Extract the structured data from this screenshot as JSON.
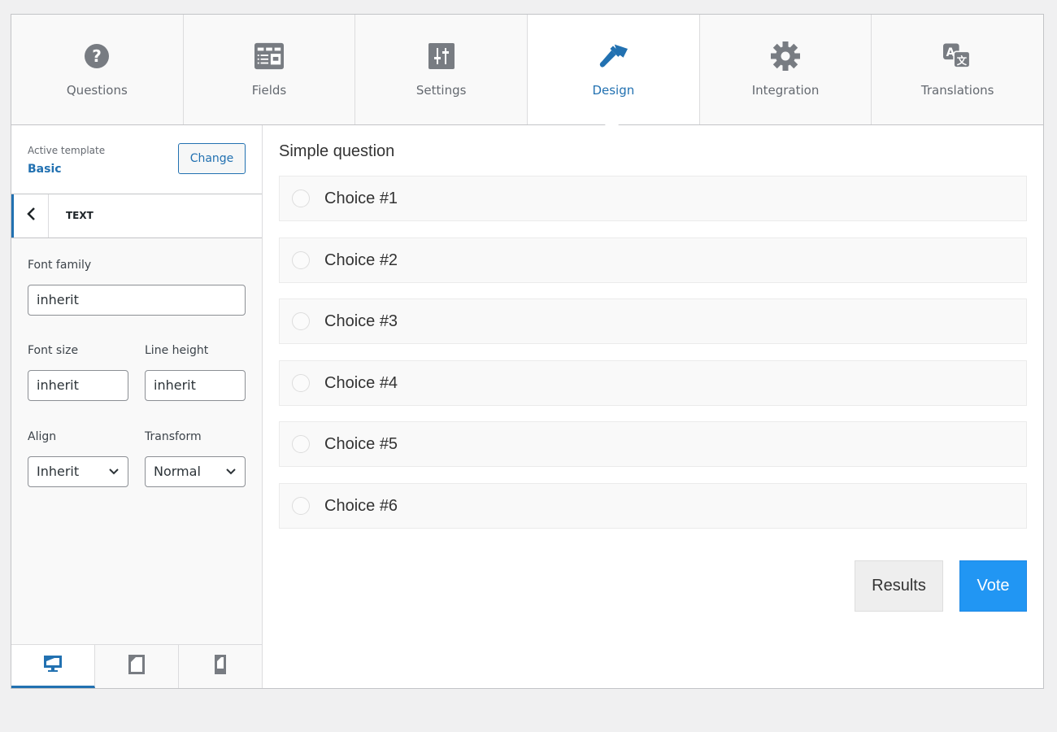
{
  "tabs": [
    {
      "label": "Questions",
      "icon": "question-circle-icon",
      "active": false
    },
    {
      "label": "Fields",
      "icon": "form-fields-icon",
      "active": false
    },
    {
      "label": "Settings",
      "icon": "sliders-icon",
      "active": false
    },
    {
      "label": "Design",
      "icon": "paintbrush-icon",
      "active": true
    },
    {
      "label": "Integration",
      "icon": "gear-icon",
      "active": false
    },
    {
      "label": "Translations",
      "icon": "translation-icon",
      "active": false
    }
  ],
  "sidebar": {
    "template_label": "Active template",
    "template_name": "Basic",
    "change_label": "Change",
    "section_title": "TEXT",
    "font_family": {
      "label": "Font family",
      "value": "inherit"
    },
    "font_size": {
      "label": "Font size",
      "value": "inherit"
    },
    "line_height": {
      "label": "Line height",
      "value": "inherit"
    },
    "align": {
      "label": "Align",
      "value": "Inherit"
    },
    "transform": {
      "label": "Transform",
      "value": "Normal"
    },
    "devices": [
      {
        "name": "desktop",
        "icon": "desktop-icon",
        "active": true
      },
      {
        "name": "tablet",
        "icon": "tablet-icon",
        "active": false
      },
      {
        "name": "mobile",
        "icon": "mobile-icon",
        "active": false
      }
    ]
  },
  "preview": {
    "question": "Simple question",
    "choices": [
      "Choice #1",
      "Choice #2",
      "Choice #3",
      "Choice #4",
      "Choice #5",
      "Choice #6"
    ],
    "results_label": "Results",
    "vote_label": "Vote"
  },
  "colors": {
    "accent": "#2271b1",
    "vote_button": "#2196f3",
    "icon_gray": "#787c82"
  }
}
